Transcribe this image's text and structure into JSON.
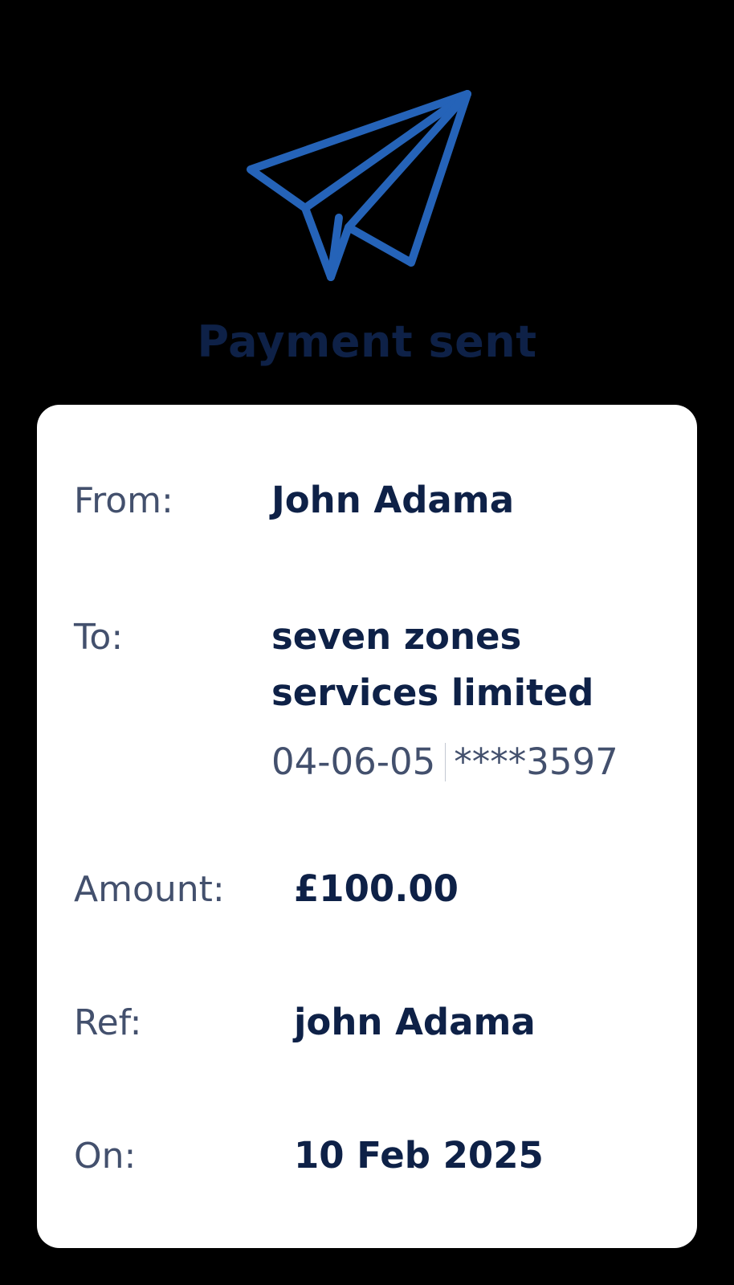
{
  "header": {
    "icon": "paper-plane-icon",
    "title": "Payment sent"
  },
  "details": {
    "from_label": "From:",
    "from_value": "John Adama",
    "to_label": "To:",
    "to_value": "seven zones services limited",
    "sort_code": "04-06-05",
    "account_number": "****3597",
    "amount_label": "Amount:",
    "amount_value": "£100.00",
    "ref_label": "Ref:",
    "ref_value": "john Adama",
    "on_label": "On:",
    "on_value": "10 Feb 2025"
  },
  "colors": {
    "background": "#000000",
    "icon": "#2563b8",
    "title": "#0e2147",
    "value_text": "#0e2147",
    "label_text": "#43506d",
    "card": "#ffffff"
  }
}
